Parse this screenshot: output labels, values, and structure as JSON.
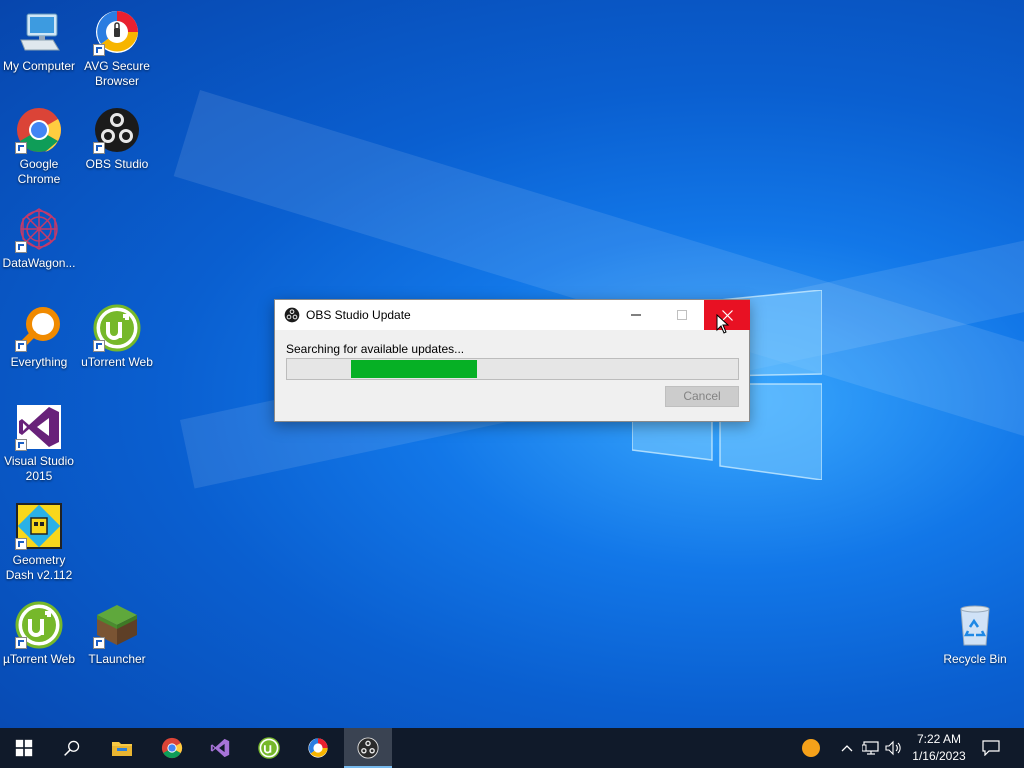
{
  "desktop_icons": [
    {
      "label": "My Computer",
      "icon": "computer-icon"
    },
    {
      "label": "AVG Secure Browser",
      "icon": "avg-browser-icon"
    },
    {
      "label": "Google Chrome",
      "icon": "chrome-icon"
    },
    {
      "label": "OBS Studio",
      "icon": "obs-icon"
    },
    {
      "label": "DataWagon...",
      "icon": "datawagon-icon"
    },
    {
      "label": "Everything",
      "icon": "everything-icon"
    },
    {
      "label": "uTorrent Web",
      "icon": "utorrent-icon"
    },
    {
      "label": "Visual Studio 2015",
      "icon": "visual-studio-icon"
    },
    {
      "label": "Geometry Dash v2.112",
      "icon": "geometry-dash-icon"
    },
    {
      "label": "µTorrent Web",
      "icon": "utorrent-icon"
    },
    {
      "label": "TLauncher",
      "icon": "tlauncher-icon"
    },
    {
      "label": "Recycle Bin",
      "icon": "recycle-bin-icon"
    }
  ],
  "dialog": {
    "title": "OBS Studio Update",
    "status": "Searching for available updates...",
    "cancel_label": "Cancel",
    "progress_state": "indeterminate"
  },
  "taskbar": {
    "items": [
      "start-icon",
      "search-icon",
      "file-explorer-icon",
      "chrome-icon",
      "visual-studio-icon",
      "utorrent-icon",
      "avg-browser-icon",
      "obs-icon"
    ],
    "active_item": "obs-icon",
    "time": "7:22 AM",
    "date": "1/16/2023"
  },
  "colors": {
    "close_button": "#e81123",
    "progress_fill": "#06b025",
    "taskbar": "#101a2a"
  }
}
